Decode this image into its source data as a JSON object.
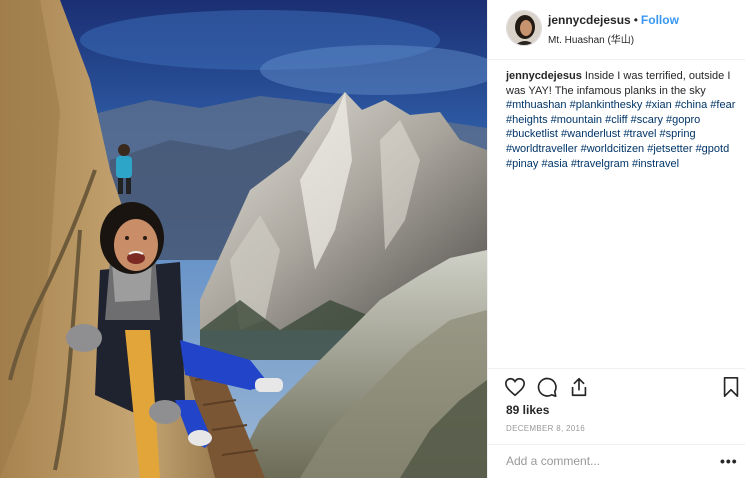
{
  "post": {
    "username": "jennycdejesus",
    "follow_label": "Follow",
    "separator": "•",
    "location": "Mt. Huashan (华山)",
    "caption": {
      "username": "jennycdejesus",
      "text": "Inside I was terrified, outside I was YAY! The infamous planks in the sky",
      "hashtags": [
        "#mthuashan",
        "#plankinthesky",
        "#xian",
        "#china",
        "#fear",
        "#heights",
        "#mountain",
        "#cliff",
        "#scary",
        "#gopro",
        "#bucketlist",
        "#wanderlust",
        "#travel",
        "#spring",
        "#worldtraveller",
        "#worldcitizen",
        "#jetsetter",
        "#gpotd",
        "#pinay",
        "#asia",
        "#travelgram",
        "#instravel"
      ]
    },
    "likes": "89 likes",
    "date": "DECEMBER 8, 2016",
    "comment_placeholder": "Add a comment...",
    "more_label": "•••"
  },
  "icons": {
    "like": "heart-icon",
    "comment": "comment-icon",
    "share": "share-icon",
    "save": "bookmark-icon",
    "more": "more-options-icon"
  },
  "colors": {
    "follow": "#3897f0",
    "hashtag": "#003569",
    "muted": "#999999",
    "border": "#efefef"
  }
}
